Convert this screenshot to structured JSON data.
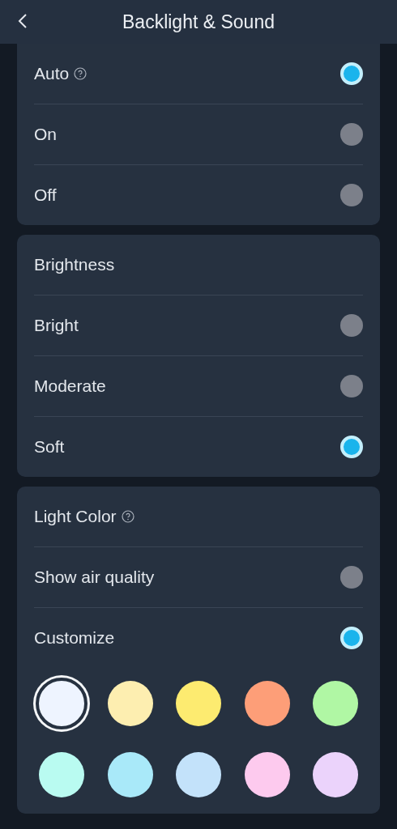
{
  "header": {
    "title": "Backlight & Sound"
  },
  "groups": [
    {
      "options": [
        {
          "label": "Auto",
          "help": true,
          "selected": true
        },
        {
          "label": "On",
          "selected": false
        },
        {
          "label": "Off",
          "selected": false
        }
      ]
    },
    {
      "title": {
        "label": "Brightness"
      },
      "options": [
        {
          "label": "Bright",
          "selected": false
        },
        {
          "label": "Moderate",
          "selected": false
        },
        {
          "label": "Soft",
          "selected": true
        }
      ]
    },
    {
      "title": {
        "label": "Light Color",
        "help": true
      },
      "options": [
        {
          "label": "Show air quality",
          "selected": false
        },
        {
          "label": "Customize",
          "selected": true
        }
      ],
      "swatches": [
        {
          "color": "#eef4ff",
          "selected": true
        },
        {
          "color": "#fdeeb0",
          "selected": false
        },
        {
          "color": "#fdeb70",
          "selected": false
        },
        {
          "color": "#fd9e78",
          "selected": false
        },
        {
          "color": "#b0f7a4",
          "selected": false
        },
        {
          "color": "#b9fbf1",
          "selected": false
        },
        {
          "color": "#a9e9f9",
          "selected": false
        },
        {
          "color": "#c3e2fa",
          "selected": false
        },
        {
          "color": "#fdcaee",
          "selected": false
        },
        {
          "color": "#ebd3fb",
          "selected": false
        }
      ]
    }
  ]
}
